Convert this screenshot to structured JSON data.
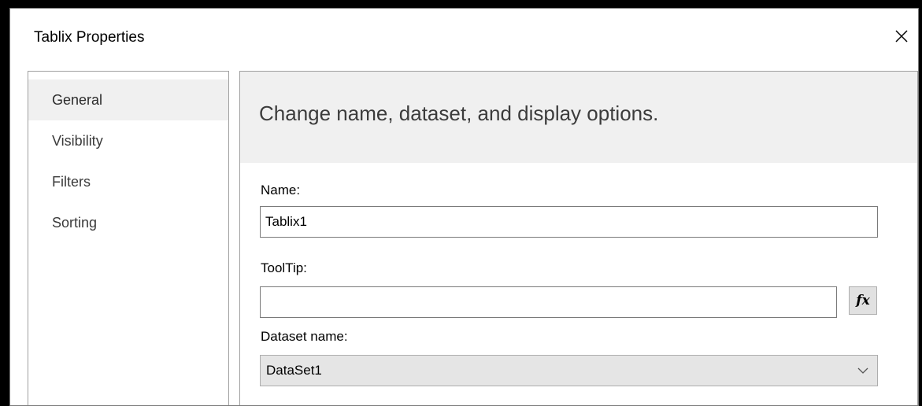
{
  "window": {
    "title": "Tablix Properties"
  },
  "sidebar": {
    "items": [
      {
        "label": "General",
        "selected": true
      },
      {
        "label": "Visibility",
        "selected": false
      },
      {
        "label": "Filters",
        "selected": false
      },
      {
        "label": "Sorting",
        "selected": false
      }
    ]
  },
  "main": {
    "header": "Change name, dataset, and display options.",
    "name_label": "Name:",
    "name_value": "Tablix1",
    "tooltip_label": "ToolTip:",
    "tooltip_value": "",
    "fx_label": "fx",
    "dataset_label": "Dataset name:",
    "dataset_value": "DataSet1"
  },
  "icons": {
    "close": "close-icon",
    "fx": "fx-expression-icon",
    "dropdown": "chevron-down-icon"
  },
  "colors": {
    "header_bg": "#f0f0f0",
    "selected_item_bg": "#f0f0f0",
    "border": "#a0a0a0",
    "select_bg": "#e5e5e5"
  }
}
